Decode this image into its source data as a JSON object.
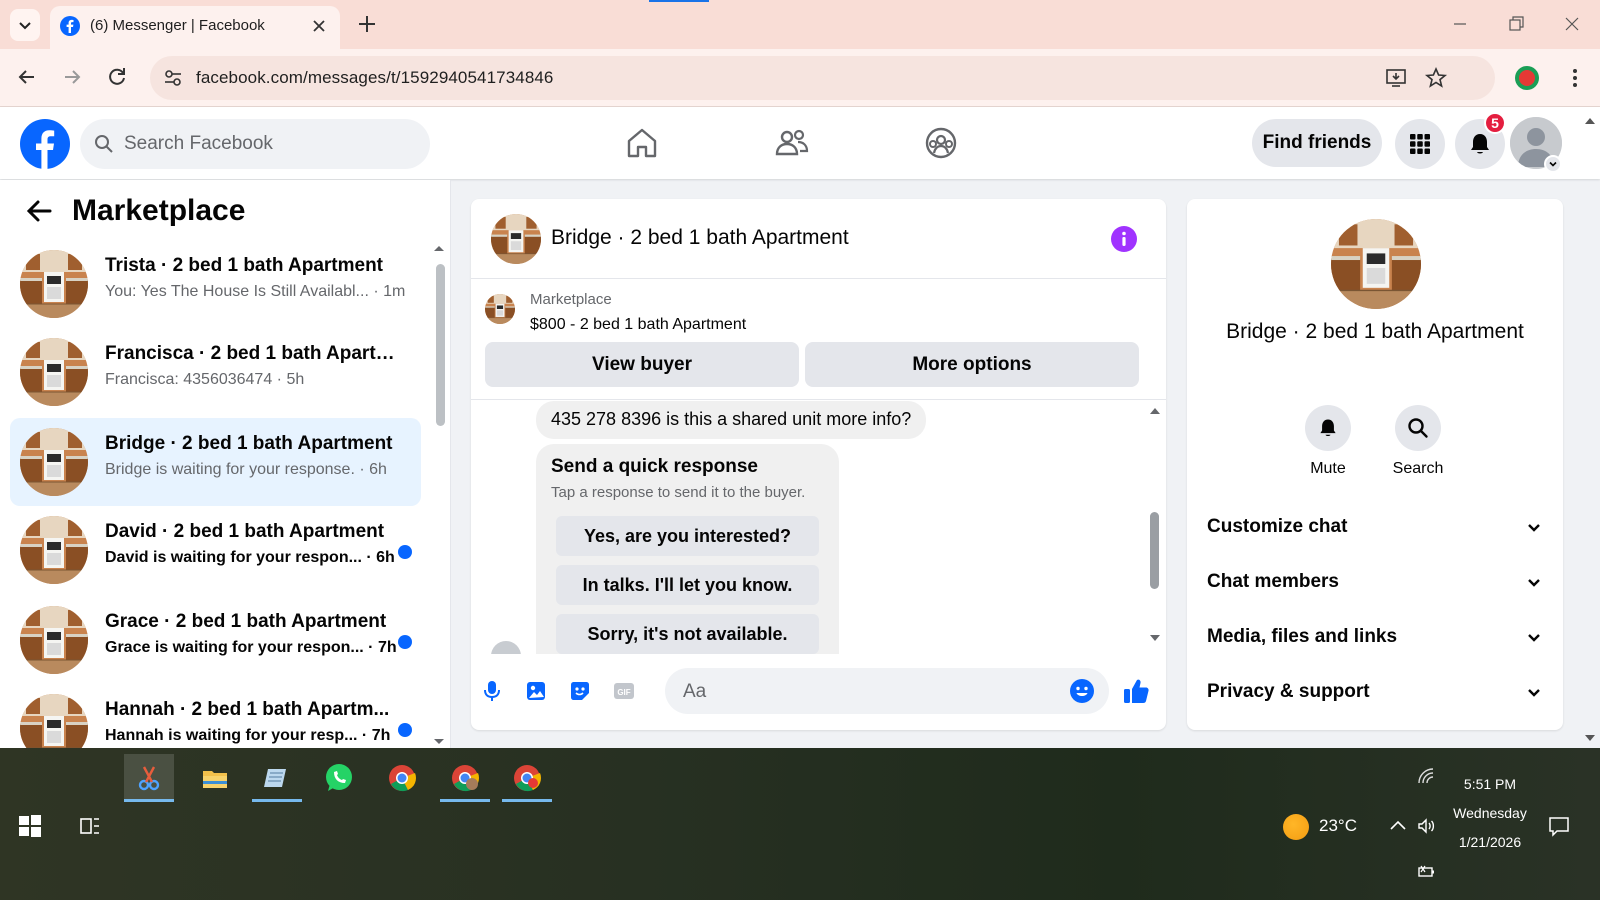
{
  "browser": {
    "tab_title": "(6) Messenger | Facebook",
    "url": "facebook.com/messages/t/1592940541734846"
  },
  "fb": {
    "search_placeholder": "Search Facebook",
    "find_friends": "Find friends",
    "notifications_count": "5"
  },
  "left": {
    "title": "Marketplace",
    "chats": [
      {
        "title": "Trista · 2 bed 1 bath Apartment",
        "sub": "You: Yes The House Is Still Availabl... · 1m",
        "unread": false,
        "active": false
      },
      {
        "title": "Francisca · 2 bed 1 bath Apartm...",
        "sub": "Francisca: 4356036474 · 5h",
        "unread": false,
        "active": false
      },
      {
        "title": "Bridge · 2 bed 1 bath Apartment",
        "sub": "Bridge is waiting for your response. · 6h",
        "unread": false,
        "active": true
      },
      {
        "title": "David · 2 bed 1 bath Apartment",
        "sub": "David is waiting for your respon... · 6h",
        "unread": true,
        "active": false
      },
      {
        "title": "Grace · 2 bed 1 bath Apartment",
        "sub": "Grace is waiting for your respon... · 7h",
        "unread": true,
        "active": false
      },
      {
        "title": "Hannah · 2 bed 1 bath Apartm...",
        "sub": "Hannah is waiting for your resp... · 7h",
        "unread": true,
        "active": false
      }
    ]
  },
  "convo": {
    "title": "Bridge · 2 bed 1 bath Apartment",
    "marketplace_label": "Marketplace",
    "listing": "$800 - 2 bed 1 bath Apartment",
    "view_buyer": "View buyer",
    "more_options": "More options",
    "message": "435 278 8396 is this a shared unit more info?",
    "quick_title": "Send a quick response",
    "quick_sub": "Tap a response to send it to the buyer.",
    "quick_replies": [
      "Yes, are you interested?",
      "In talks. I'll let you know.",
      "Sorry, it's not available."
    ],
    "composer_placeholder": "Aa"
  },
  "info": {
    "title": "Bridge · 2 bed 1 bath Apartment",
    "mute": "Mute",
    "search": "Search",
    "sections": [
      "Customize chat",
      "Chat members",
      "Media, files and links",
      "Privacy & support"
    ]
  },
  "taskbar": {
    "temperature": "23°C",
    "time": "5:51 PM",
    "day": "Wednesday",
    "date": "1/21/2026"
  },
  "colors": {
    "fb_blue": "#0866ff",
    "active_chat": "#e7f3ff",
    "info_purple": "#a033ff",
    "badge_red": "#e41e3f"
  }
}
